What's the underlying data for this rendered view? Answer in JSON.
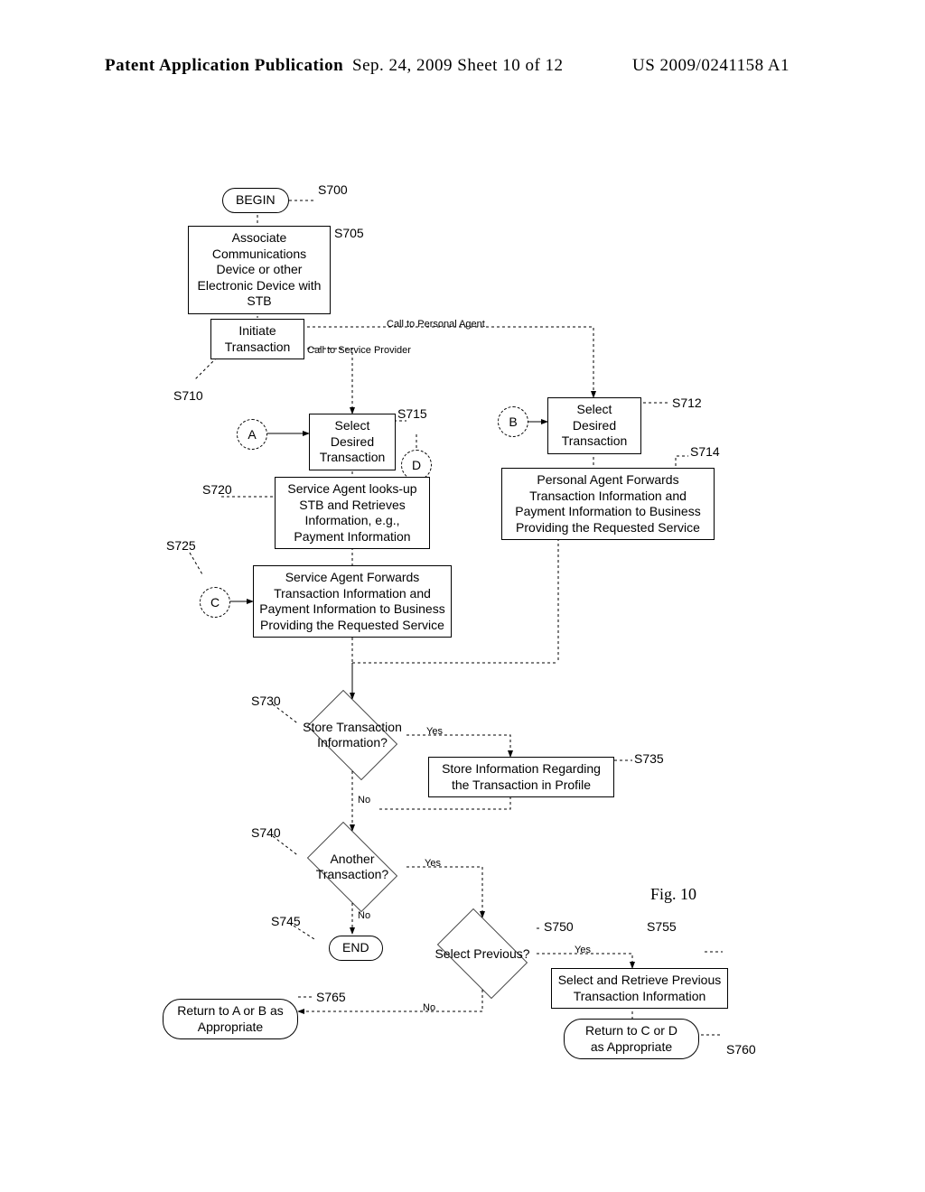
{
  "header": {
    "left": "Patent Application Publication",
    "mid": "Sep. 24, 2009  Sheet 10 of 12",
    "right": "US 2009/0241158 A1"
  },
  "figure_label": "Fig. 10",
  "terminators": {
    "begin": "BEGIN",
    "end": "END",
    "return_ab": "Return to A or B as Appropriate",
    "return_cd": "Return to C or D as Appropriate"
  },
  "connectors": {
    "A": "A",
    "B": "B",
    "C": "C",
    "D": "D"
  },
  "boxes": {
    "s705": "Associate Communications Device or other Electronic Device with STB",
    "s710_initiate": "Initiate Transaction",
    "s715": "Select Desired Transaction",
    "s712": "Select Desired Transaction",
    "s714": "Personal Agent Forwards Transaction Information and Payment Information to Business Providing the Requested Service",
    "s720": "Service Agent looks-up STB and Retrieves Information, e.g., Payment Information",
    "s725": "Service Agent Forwards Transaction Information and Payment Information to Business Providing the Requested Service",
    "s735": "Store Information Regarding the Transaction in Profile",
    "s755": "Select and Retrieve Previous Transaction Information"
  },
  "decisions": {
    "s730": "Store Transaction Information?",
    "s740": "Another Transaction?",
    "s750": "Select Previous?"
  },
  "step_labels": {
    "s700": "S700",
    "s705": "S705",
    "s710": "S710",
    "s712": "S712",
    "s714": "S714",
    "s715": "S715",
    "s720": "S720",
    "s725": "S725",
    "s730": "S730",
    "s735": "S735",
    "s740": "S740",
    "s745": "S745",
    "s750": "S750",
    "s755": "S755",
    "s760": "S760",
    "s765": "S765"
  },
  "edge_labels": {
    "call_personal": "Call to Personal Agent",
    "call_service": "Call to Service Provider",
    "yes": "Yes",
    "no": "No"
  }
}
